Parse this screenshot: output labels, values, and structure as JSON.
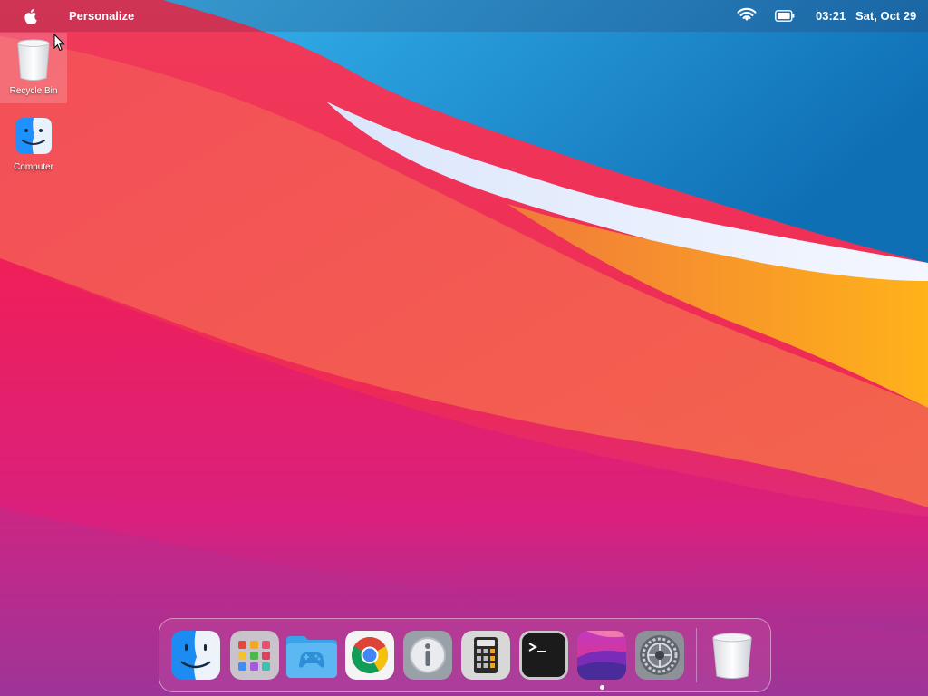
{
  "menubar": {
    "app_name": "Personalize",
    "time": "03:21",
    "date": "Sat, Oct 29",
    "icons": [
      "apple-icon",
      "wifi-icon",
      "battery-icon"
    ]
  },
  "desktop": {
    "items": [
      {
        "label": "Recycle Bin",
        "icon": "trash-icon",
        "selected": true
      },
      {
        "label": "Computer",
        "icon": "finder-icon",
        "selected": false
      }
    ]
  },
  "dock": {
    "items": [
      {
        "icon": "finder-icon"
      },
      {
        "icon": "launchpad-icon"
      },
      {
        "icon": "games-folder-icon"
      },
      {
        "icon": "chrome-icon"
      },
      {
        "icon": "info-icon"
      },
      {
        "icon": "calculator-icon"
      },
      {
        "icon": "terminal-icon"
      },
      {
        "icon": "wallpaper-icon",
        "running": true
      },
      {
        "icon": "settings-icon"
      },
      {
        "icon": "trash-icon"
      }
    ]
  },
  "colors": {
    "menubar_text": "#ffffff",
    "wallpaper_red": "#f0304f",
    "wallpaper_blue": "#1c8fd6",
    "wallpaper_orange": "#f7a21c",
    "wallpaper_magenta": "#d8338f"
  }
}
